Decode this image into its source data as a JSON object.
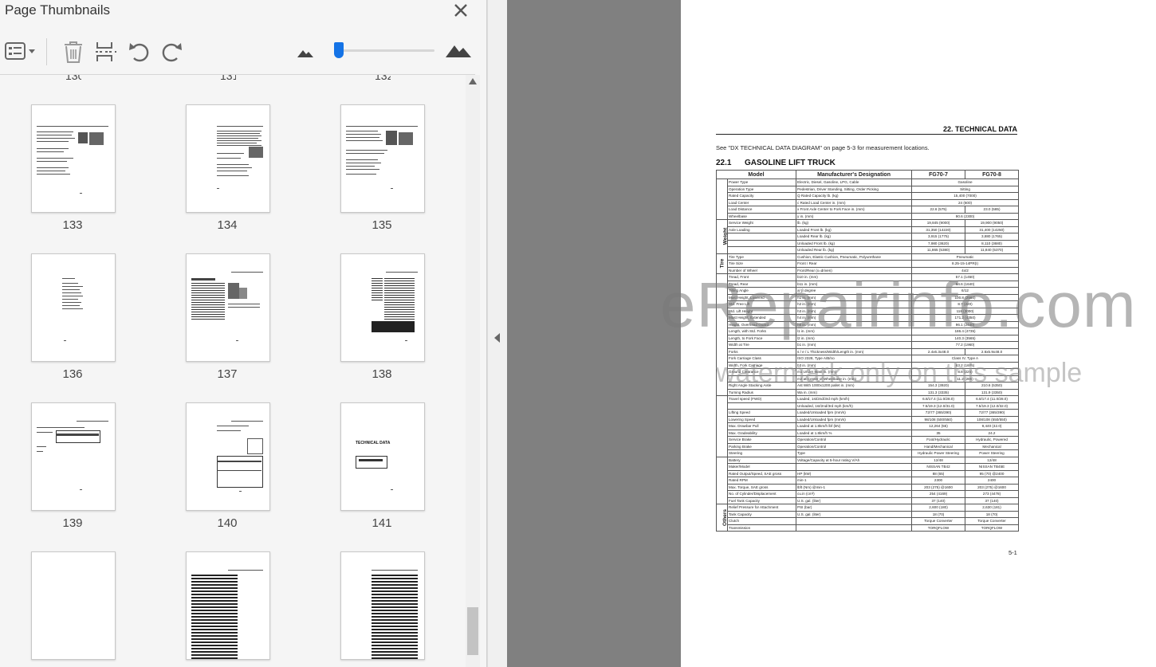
{
  "panel": {
    "title": "Page Thumbnails",
    "partial_labels": [
      "130",
      "131",
      "132"
    ],
    "thumbnails": [
      {
        "label": "133"
      },
      {
        "label": "134"
      },
      {
        "label": "135"
      },
      {
        "label": "136"
      },
      {
        "label": "137"
      },
      {
        "label": "138"
      },
      {
        "label": "139"
      },
      {
        "label": "140"
      },
      {
        "label": "141"
      },
      {
        "label": ""
      },
      {
        "label": ""
      },
      {
        "label": ""
      }
    ],
    "thumb_141_title": "TECHNICAL DATA",
    "icons": {
      "options": "list-options-icon",
      "delete": "trash-icon",
      "extract": "insert-pages-icon",
      "undo": "rotate-counterclockwise-icon",
      "redo": "rotate-clockwise-icon",
      "zoom_out": "small-mountain-icon",
      "zoom_in": "large-mountain-icon"
    },
    "accent": "#1473e6"
  },
  "document": {
    "header": "22. TECHNICAL DATA",
    "note": "See \"DX TECHNICAL DATA DIAGRAM\" on page 5-3 for measurement locations.",
    "section_number": "22.1",
    "section_title": "GASOLINE LIFT TRUCK",
    "columns": [
      "Model",
      "Manufacturer's Designation",
      "FG70-7",
      "FG70-8"
    ],
    "groups": [
      "Characteristics",
      "Weight",
      "Tire",
      "Basic Measurement",
      "Performance",
      "I.C. Engine",
      "Others"
    ],
    "rows": [
      [
        "Power Type",
        "Electric, Diesel, Gasoline, LPG, Cable",
        "",
        "Gasoline"
      ],
      [
        "Operation Type",
        "Pedestrian, Driver Standing, Sitting, Order Picking",
        "",
        "Sitting"
      ],
      [
        "Rated Capacity",
        "Q   Rated Capacity   lb. (kg)",
        "",
        "15,400 (7000)"
      ],
      [
        "Load Center",
        "c   Rated Load Center   in. (mm)",
        "",
        "24 (600)"
      ],
      [
        "Load Distance",
        "x   Front Axle Center to Fork Face   in. (mm)",
        "22.6 (575)",
        "23.0 (585)"
      ],
      [
        "Wheelbase",
        "y   in. (mm)",
        "",
        "90.6 (2300)"
      ],
      [
        "Service Weight",
        "lb. (kg)",
        "19,845 (9000)",
        "19,900 (9050)"
      ],
      [
        "Axle Loading",
        "Loaded Front lb. (kg)",
        "31,350 (14220)",
        "31,400 (14250)"
      ],
      [
        "",
        "Loaded Rear lb. (kg)",
        "3,915 (1775)",
        "3,880 (1765)"
      ],
      [
        "",
        "Unloaded Front lb. (kg)",
        "7,980 (3620)",
        "8,110 (3680)"
      ],
      [
        "",
        "Unloaded Rear lb. (kg)",
        "11,865 (5380)",
        "11,840 (5370)"
      ],
      [
        "Tire Type",
        "Cushion, Elastic Cushion, Pneumatic, Polyurethane",
        "",
        "Pneumatic"
      ],
      [
        "Tire Size",
        "Front / Rear",
        "",
        "8.25-15-14PR(I)"
      ],
      [
        "Number of Wheel",
        "Front/Rear (x=driven)",
        "",
        "4x/2"
      ],
      [
        "Tread, Front",
        "b10   in. (mm)",
        "",
        "57.1 (1450)"
      ],
      [
        "Tread, Rear",
        "b11   in. (mm)",
        "",
        "64.6 (1640)"
      ],
      [
        "Tilting Angle",
        "a/ β   degree",
        "",
        "6/12"
      ],
      [
        "Mast Height, Lowered",
        "h1   in. (mm)",
        "",
        "100.8 (2560)"
      ],
      [
        "Std. Free Lift",
        "h2   in. (mm)",
        "",
        "8.7 (220)"
      ],
      [
        "Std. Lift Height",
        "h3   in. (mm)",
        "",
        "118 (3000)"
      ],
      [
        "Mast Height, Extended",
        "h4   in. (mm)",
        "",
        "171.2 (4350)"
      ],
      [
        "Height, Overhead Guard",
        "h6   in. (mm)",
        "",
        "96.1 (2440)"
      ],
      [
        "Length, with Std. Forks",
        "l1   in. (mm)",
        "",
        "186.4 (4735)"
      ],
      [
        "Length, to Fork Face",
        "l2   in. (mm)",
        "",
        "140.3 (3565)"
      ],
      [
        "Width at Tire",
        "b1   in. (mm)",
        "",
        "77.2 (1960)"
      ],
      [
        "Forks",
        "s / e / L   Thickness/Width/Length   in. (mm)",
        "2.4x6.3x48.0",
        "2.6x5.9x48.0"
      ],
      [
        "Fork Carriage Class",
        "ISO 2328, Type A/B/no",
        "",
        "Class IV, Type A"
      ],
      [
        "Width, Fork Carriage",
        "b3   in. (mm)",
        "",
        "63.2 (1605)"
      ],
      [
        "Ground Clearance",
        "m1 Under Mast   in. (mm)",
        "",
        "8.8 (225)"
      ],
      [
        "",
        "m2 at Center of Wheelbase   in. (mm)",
        "",
        "11.2 (285)"
      ],
      [
        "Right Angle Stacking Aisle",
        "Ast   With 1000x1200 pallet   in. (mm)",
        "154.3 (3920)",
        "210.6 (5350)"
      ],
      [
        "Turning Radius",
        "Wa   in. (mm)",
        "131.3 (3335)",
        "131.9 (3350)"
      ],
      [
        "Travel speed (FWD)",
        "Loaded, 1st/2nd/3rd   mph (km/h)",
        "6.8/17.4 (11.0/28.0)",
        "6.8/17.4 (11.0/28.0)"
      ],
      [
        "",
        "Unloaded, 1st/2nd/3rd   mph (km/h)",
        "7.5/19.3 (12.0/31.0)",
        "7.5/19.3 (12.0/32.0)"
      ],
      [
        "Lifting Speed",
        "Loaded/Unloaded   fpm (mm/s)",
        "72/77 (365/390)",
        "72/77 (365/390)"
      ],
      [
        "Lowering Speed",
        "Loaded/Unloaded   fpm (mm/s)",
        "98/108 (500/550)",
        "108/108 (550/550)"
      ],
      [
        "Max. Drawbar Pull",
        "Loaded at 1.8km/h   lbf (kN)",
        "12,264 (55)",
        "9,440 (42.0)"
      ],
      [
        "Max. Gradeability",
        "Loaded at 1.8km/h   %",
        "35",
        "24.2"
      ],
      [
        "Service Brake",
        "Operation/Control",
        "Foot/Hydraulic",
        "Hydraulic, Powered"
      ],
      [
        "Parking Brake",
        "Operation/Control",
        "Hand/Mechanical",
        "Mechanical"
      ],
      [
        "Steering",
        "Type",
        "Hydraulic Power Steering",
        "Power Steering"
      ],
      [
        "Battery",
        "Voltage/Capacity at 5-hour rating   V/Ah",
        "12/48",
        "12/48"
      ],
      [
        "Maker/Model",
        "",
        "NISSAN TB42",
        "NISSAN TB45E"
      ],
      [
        "Rated Output/Speed, SAE gross",
        "HP (kW)",
        "88 (65)",
        "95 (70) @2400"
      ],
      [
        "Rated RPM",
        "min-1",
        "2300",
        "2400"
      ],
      [
        "Max. Torque, SAE gross",
        "lbft (Nm) @min-1",
        "203 (275) @1600",
        "203 (275) @1600"
      ],
      [
        "No. of Cylinder/Displacement",
        "cu.in (cm³)",
        "254 (4169)",
        "273 (4478)"
      ],
      [
        "Fuel Tank Capacity",
        "U.S. gal. (liter)",
        "37 (140)",
        "37 (140)"
      ],
      [
        "Relief Pressure for Attachment",
        "PSI (bar)",
        "2,600 (180)",
        "2,630 (181)"
      ],
      [
        "Tank Capacity",
        "U.S. gal. (liter)",
        "18 (70)",
        "18 (70)"
      ],
      [
        "Clutch",
        "",
        "Torque Converter",
        "Torque Converter"
      ],
      [
        "Transmission",
        "",
        "TORQFLOW",
        "TORQFLOW"
      ]
    ],
    "page_number": "5-1"
  },
  "watermark": {
    "line1": "eRepairinfo.com",
    "line2": "watermark only on this sample"
  }
}
